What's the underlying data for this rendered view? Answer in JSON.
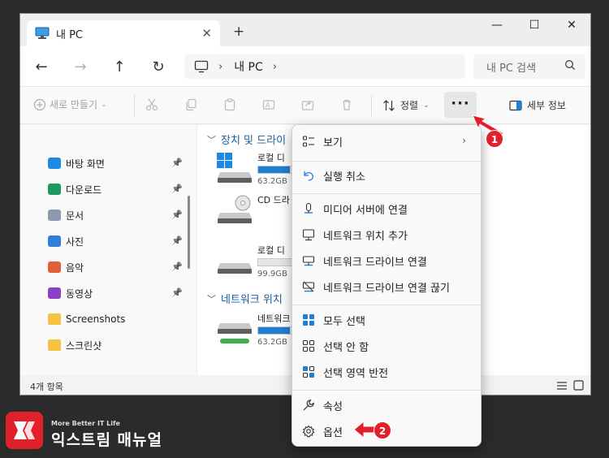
{
  "window": {
    "tab_title": "내 PC",
    "tab_close": "✕",
    "new_tab": "+",
    "minimize": "—",
    "maximize": "☐",
    "close": "✕"
  },
  "nav": {
    "back": "←",
    "forward": "→",
    "up": "↑",
    "refresh": "↻",
    "address": [
      "내 PC"
    ],
    "search_placeholder": "내 PC 검색"
  },
  "toolbar": {
    "new_label": "새로 만들기",
    "sort_label": "정렬",
    "more_label": "···",
    "details_label": "세부 정보"
  },
  "sidebar": {
    "items": [
      {
        "label": "바탕 화면",
        "icon": "desktop-icon",
        "color": "#1e88e5",
        "pinned": true
      },
      {
        "label": "다운로드",
        "icon": "download-icon",
        "color": "#1d9a5b",
        "pinned": true
      },
      {
        "label": "문서",
        "icon": "document-icon",
        "color": "#8a9bb0",
        "pinned": true
      },
      {
        "label": "사진",
        "icon": "pictures-icon",
        "color": "#2f7fd8",
        "pinned": true
      },
      {
        "label": "음악",
        "icon": "music-icon",
        "color": "#e0603a",
        "pinned": true
      },
      {
        "label": "동영상",
        "icon": "video-icon",
        "color": "#8a3fc8",
        "pinned": true
      },
      {
        "label": "Screenshots",
        "icon": "folder-icon",
        "color": "#f5c342",
        "pinned": false
      },
      {
        "label": "스크린샷",
        "icon": "folder-icon",
        "color": "#f5c342",
        "pinned": false
      }
    ]
  },
  "content": {
    "groups": [
      {
        "label": "장치 및 드라이"
      },
      {
        "label": "네트워크 위치"
      }
    ],
    "drives": [
      {
        "label": "로컬 디",
        "capacity": "63.2GB",
        "used_fraction": 0.88
      },
      {
        "label": "CD 드라",
        "capacity": "",
        "used_fraction": null
      },
      {
        "label": "로컬 디",
        "capacity": "99.9GB",
        "used_fraction": 0.0
      },
      {
        "label": "네트워크",
        "capacity": "63.2GB",
        "used_fraction": 0.88
      }
    ]
  },
  "status": {
    "count": "4개 항목"
  },
  "context_menu": {
    "items": [
      {
        "label": "보기",
        "icon": "view-icon",
        "submenu": "›"
      },
      {
        "label": "실행 취소",
        "icon": "undo-icon"
      },
      {
        "label": "미디어 서버에 연결",
        "icon": "media-server-icon"
      },
      {
        "label": "네트워크 위치 추가",
        "icon": "network-location-icon"
      },
      {
        "label": "네트워크 드라이브 연결",
        "icon": "map-drive-icon"
      },
      {
        "label": "네트워크 드라이브 연결 끊기",
        "icon": "disconnect-drive-icon"
      },
      {
        "label": "모두 선택",
        "icon": "select-all-icon"
      },
      {
        "label": "선택 안 함",
        "icon": "select-none-icon"
      },
      {
        "label": "선택 영역 반전",
        "icon": "invert-selection-icon"
      },
      {
        "label": "속성",
        "icon": "properties-icon"
      },
      {
        "label": "옵션",
        "icon": "options-icon"
      }
    ]
  },
  "annotations": {
    "step1": "1",
    "step2": "2"
  },
  "logo": {
    "tagline": "More Better IT Life",
    "name": "익스트림 매뉴얼",
    "mark": "EX"
  },
  "colors": {
    "accent": "#1e7fd6",
    "badge": "#e0202a",
    "background": "#2b2b2b"
  }
}
